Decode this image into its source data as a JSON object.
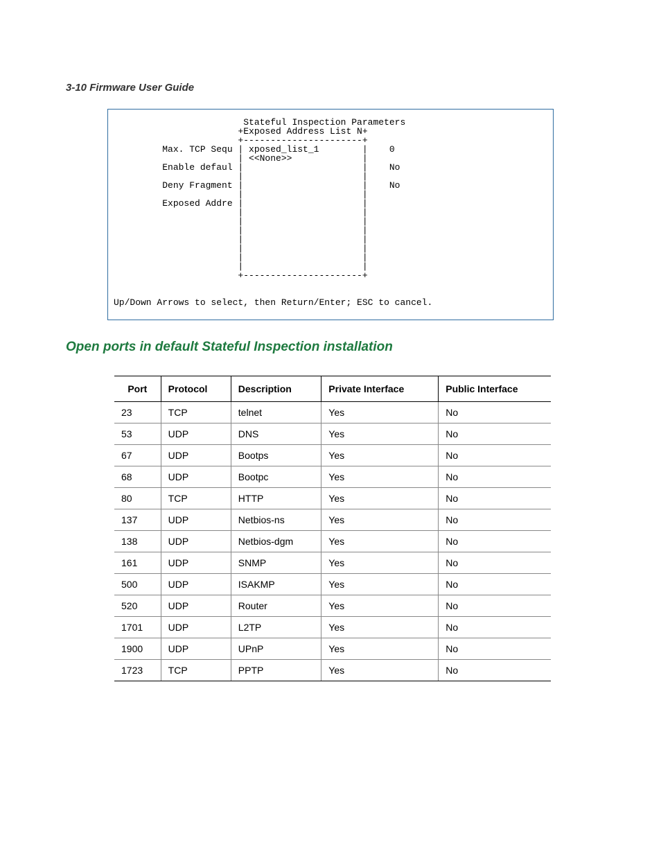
{
  "page_header": "3-10  Firmware User Guide",
  "terminal": {
    "title": "Stateful Inspection Parameters",
    "popup_title": "+Exposed Address List N+",
    "border_top": "+----------------------+",
    "rows": [
      {
        "left": "Max. TCP Sequ",
        "mid_top": "xposed_list_1",
        "mid_bot": "<<None>>",
        "right": "0"
      },
      {
        "left": "Enable defaul",
        "mid_top": "",
        "mid_bot": "",
        "right": "No"
      },
      {
        "left": "Deny Fragment",
        "mid_top": "",
        "mid_bot": "",
        "right": "No"
      },
      {
        "left": "Exposed Addre",
        "mid_top": "",
        "mid_bot": "",
        "right": ""
      }
    ],
    "border_bot": "+----------------------+",
    "hint": "Up/Down Arrows to select, then Return/Enter; ESC to cancel."
  },
  "section_heading": "Open ports in default Stateful Inspection installation",
  "table": {
    "headers": [
      "Port",
      "Protocol",
      "Description",
      "Private Interface",
      "Public Interface"
    ],
    "rows": [
      [
        "23",
        "TCP",
        "telnet",
        "Yes",
        "No"
      ],
      [
        "53",
        "UDP",
        "DNS",
        "Yes",
        "No"
      ],
      [
        "67",
        "UDP",
        "Bootps",
        "Yes",
        "No"
      ],
      [
        "68",
        "UDP",
        "Bootpc",
        "Yes",
        "No"
      ],
      [
        "80",
        "TCP",
        "HTTP",
        "Yes",
        "No"
      ],
      [
        "137",
        "UDP",
        "Netbios-ns",
        "Yes",
        "No"
      ],
      [
        "138",
        "UDP",
        "Netbios-dgm",
        "Yes",
        "No"
      ],
      [
        "161",
        "UDP",
        "SNMP",
        "Yes",
        "No"
      ],
      [
        "500",
        "UDP",
        "ISAKMP",
        "Yes",
        "No"
      ],
      [
        "520",
        "UDP",
        "Router",
        "Yes",
        "No"
      ],
      [
        "1701",
        "UDP",
        "L2TP",
        "Yes",
        "No"
      ],
      [
        "1900",
        "UDP",
        "UPnP",
        "Yes",
        "No"
      ],
      [
        "1723",
        "TCP",
        "PPTP",
        "Yes",
        "No"
      ]
    ]
  }
}
